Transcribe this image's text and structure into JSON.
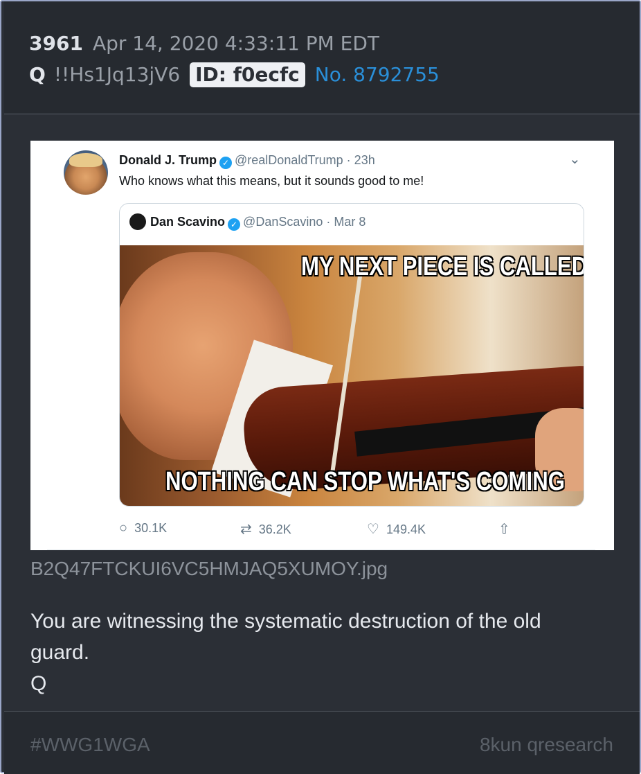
{
  "post": {
    "number": "3961",
    "timestamp": "Apr 14, 2020 4:33:11 PM EDT",
    "author": "Q",
    "tripcode": "!!Hs1Jq13jV6",
    "id_label": "ID: f0ecfc",
    "post_no": "No. 8792755"
  },
  "image": {
    "filename": "B2Q47FTCKUI6VC5HMJAQ5XUMOY.jpg",
    "tweet": {
      "name": "Donald J. Trump",
      "handle_time": "@realDonaldTrump · 23h",
      "text": "Who knows what this means, but it sounds good to me!",
      "quoted": {
        "name": "Dan Scavino",
        "handle_time": "@DanScavino · Mar 8",
        "meme_top": "MY NEXT PIECE IS CALLED",
        "meme_bottom": "NOTHING CAN STOP WHAT'S COMING"
      },
      "replies": "30.1K",
      "retweets": "36.2K",
      "likes": "149.4K"
    }
  },
  "message": {
    "line1": "You are witnessing the systematic destruction of the old guard.",
    "signature": "Q"
  },
  "footer": {
    "hashtag": "#WWG1WGA",
    "source": "8kun qresearch"
  },
  "colors": {
    "card_bg": "#2b2f36",
    "link_blue": "#2a8fd8",
    "twitter_blue": "#1da1f2"
  },
  "icons": [
    "verified-icon",
    "chevron-down-icon",
    "reply-icon",
    "retweet-icon",
    "like-icon",
    "share-icon"
  ]
}
